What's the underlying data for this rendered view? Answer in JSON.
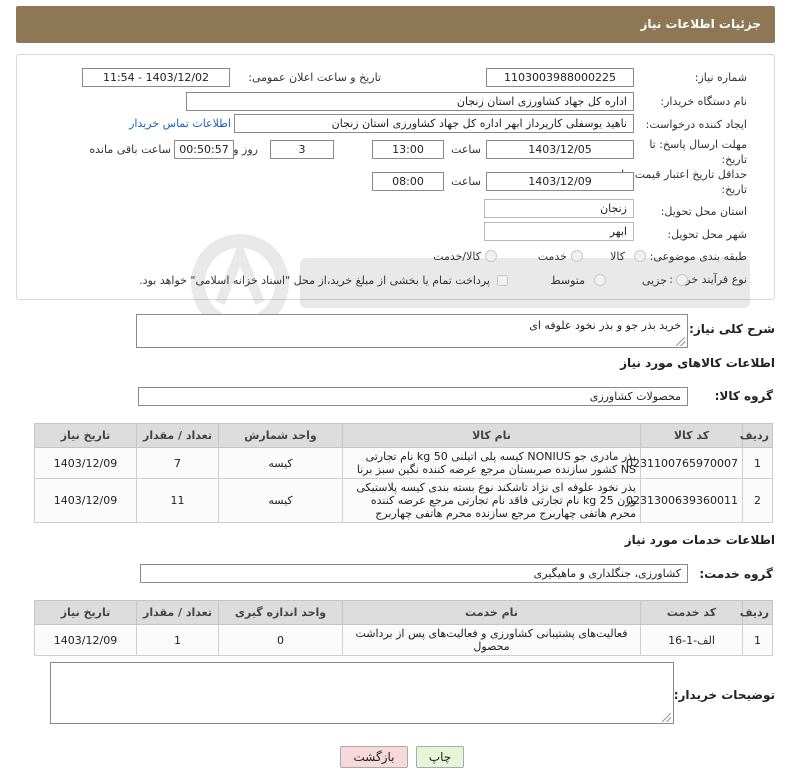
{
  "header": {
    "title": "جزئیات اطلاعات نیاز"
  },
  "form": {
    "need_number_label": "شماره نیاز:",
    "need_number": "1103003988000225",
    "announce_label": "تاریخ و ساعت اعلان عمومی:",
    "announce_value": "1403/12/02 - 11:54",
    "buyer_org_label": "نام دستگاه خریدار:",
    "buyer_org": "اداره کل جهاد کشاورزی استان زنجان",
    "creator_label": "ایجاد کننده درخواست:",
    "creator": "ناهید یوسفلی کارپرداز ابهر اداره کل جهاد کشاورزی استان زنجان",
    "contact_link": "اطلاعات تماس خریدار",
    "deadline_label_1": "مهلت ارسال پاسخ: تا",
    "deadline_label_2": "تاریخ:",
    "deadline_date": "1403/12/05",
    "time_label": "ساعت",
    "deadline_time": "13:00",
    "days_value": "3",
    "days_label": "روز و",
    "remaining_value": "00:50:57",
    "remaining_label": "ساعت باقی مانده",
    "validity_label_1": "حداقل تاریخ اعتبار قیمت: تا",
    "validity_label_2": "تاریخ:",
    "validity_date": "1403/12/09",
    "validity_time": "08:00",
    "province_label": "استان محل تحویل:",
    "province": "زنجان",
    "city_label": "شهر محل تحویل:",
    "city": "ابهر",
    "category_label": "طبقه بندی موضوعی:",
    "category_options": [
      "کالا",
      "خدمت",
      "کالا/خدمت"
    ],
    "process_label": "نوع فرآیند خرید :",
    "process_options": [
      "جزیی",
      "متوسط"
    ],
    "payment_note": "پرداخت تمام یا بخشی از مبلغ خرید،از محل \"اسناد خزانه اسلامی\" خواهد بود."
  },
  "description": {
    "label": "شرح کلی نیاز:",
    "value": "خرید بذر جو و بذر نخود علوفه ای"
  },
  "goods": {
    "section_title": "اطلاعات کالاهای مورد نیاز",
    "group_label": "گروه کالا:",
    "group_value": "محصولات کشاورزی",
    "headers": [
      "ردیف",
      "کد کالا",
      "نام کالا",
      "واحد شمارش",
      "تعداد / مقدار",
      "تاریخ نیاز"
    ],
    "rows": [
      {
        "idx": "1",
        "code": "0231100765970007",
        "name": "بذر مادری جو NONIUS کیسه پلی اتیلنی 50 kg نام تجارتی NS کشور سازنده صربستان مرجع عرضه کننده نگین سبز برنا",
        "unit": "کیسه",
        "qty": "7",
        "date": "1403/12/09"
      },
      {
        "idx": "2",
        "code": "0231300639360011",
        "name": "بذر نخود علوفه ای نژاد تاشکند نوع بسته بندی کیسه پلاستیکی وزن 25 kg نام تجارتی فاقد نام تجارتی مرجع عرضه کننده محرم هاتفی چهاربرج مرجع سازنده محرم هاتفی چهاربرج",
        "unit": "کیسه",
        "qty": "11",
        "date": "1403/12/09"
      }
    ]
  },
  "services": {
    "section_title": "اطلاعات خدمات مورد نیاز",
    "group_label": "گروه خدمت:",
    "group_value": "کشاورزی، جنگلداری و ماهیگیری",
    "headers": [
      "ردیف",
      "کد خدمت",
      "نام خدمت",
      "واحد اندازه گیری",
      "تعداد / مقدار",
      "تاریخ نیاز"
    ],
    "rows": [
      {
        "idx": "1",
        "code": "الف-1-16",
        "name": "فعالیت‌های پشتیبانی کشاورزی و فعالیت‌های پس از برداشت محصول",
        "unit": "0",
        "qty": "1",
        "date": "1403/12/09"
      }
    ]
  },
  "buyer_notes": {
    "label": "توضیحات خریدار:",
    "value": ""
  },
  "buttons": {
    "print": "چاپ",
    "back": "بازگشت"
  },
  "colors": {
    "header_bg": "#8d7754",
    "link": "#1d5fbf",
    "print_btn": "#e6f5d8",
    "back_btn": "#f7d9d9"
  }
}
